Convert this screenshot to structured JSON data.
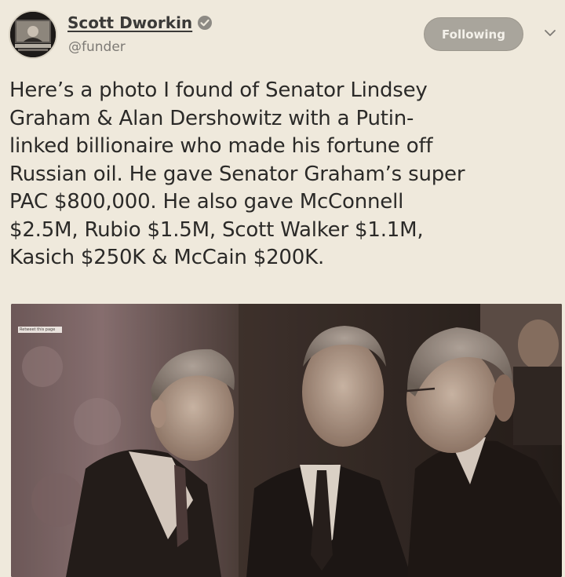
{
  "author": {
    "display_name": "Scott Dworkin",
    "handle": "@funder",
    "verified": true
  },
  "follow_button": {
    "label": "Following"
  },
  "tweet": {
    "lines": [
      "Here’s a photo I found of Senator Lindsey",
      "Graham & Alan Dershowitz with a Putin-",
      "linked billionaire who made his fortune off",
      "Russian oil. He gave Senator Graham’s super",
      "PAC $800,000. He also gave McConnell",
      "$2.5M, Rubio $1.5M, Scott Walker $1.1M,",
      "Kasich $250K & McCain $200K."
    ]
  },
  "photo": {
    "caption_tag": "Retweet this page"
  },
  "icons": {
    "verified": "verified-badge-icon",
    "caret": "chevron-down-icon"
  },
  "colors": {
    "background": "#efe9dc",
    "text": "#2b2a28",
    "button": "#a9a59c"
  }
}
